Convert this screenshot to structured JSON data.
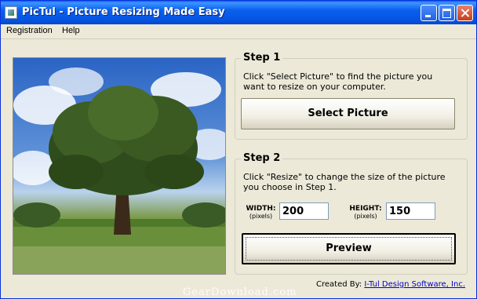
{
  "window": {
    "title": "PicTul - Picture Resizing Made Easy"
  },
  "menu": [
    "Registration",
    "Help"
  ],
  "step1": {
    "title": "Step 1",
    "description_line1": "Click \"Select Picture\" to find the picture you",
    "description_line2": "want to resize on your computer.",
    "button_label": "Select Picture"
  },
  "step2": {
    "title": "Step 2",
    "description_line1": "Click \"Resize\" to change the size of the picture",
    "description_line2": "you choose in Step 1.",
    "width_label": "WIDTH:",
    "width_unit": "(pixels)",
    "width_value": "200",
    "height_label": "HEIGHT:",
    "height_unit": "(pixels)",
    "height_value": "150",
    "button_label": "Preview"
  },
  "credit": {
    "prefix": "Created By:",
    "link": "I-Tul Design  Software, Inc."
  },
  "watermark": "GearDownload.com",
  "colors": {
    "titlebar": "#0A5FEF",
    "close": "#C63D1C",
    "face": "#ECE9D8",
    "link": "#0000C0"
  },
  "icons": {
    "app": "app-icon",
    "minimize": "minimize-icon",
    "maximize": "maximize-icon",
    "close": "close-icon"
  }
}
